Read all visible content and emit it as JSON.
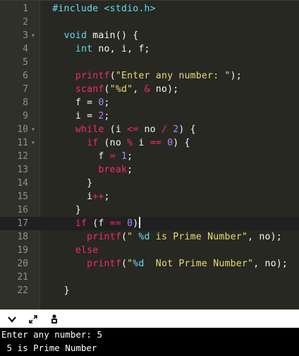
{
  "editor": {
    "line_numbers": [
      "1",
      "2",
      "3",
      "4",
      "5",
      "6",
      "7",
      "8",
      "9",
      "10",
      "11",
      "12",
      "13",
      "14",
      "15",
      "16",
      "17",
      "18",
      "19",
      "20",
      "21",
      "22"
    ],
    "fold_markers": {
      "3": "▾",
      "10": "▾",
      "11": "▾"
    },
    "active_line": 17,
    "code": {
      "include": "#include <stdio.h>",
      "void": "void",
      "main": " main() {",
      "int": "int",
      "vars": " no, i, f;",
      "printf": "printf",
      "scanf": "scanf",
      "enter_str": "\"Enter any number: \"",
      "fmt_d": "\"%d\"",
      "amp": "&",
      "no_arg": " no);",
      "f_eq": "f = ",
      "i_eq": "i = ",
      "zero": "0",
      "one": "1",
      "two": "2",
      "semi": ";",
      "while": "while",
      "while_cond_a": " (i ",
      "le": "<=",
      "while_cond_b": " no ",
      "div": "/",
      "while_cond_c": " ",
      "while_end": ") {",
      "if": "if",
      "if_cond_a": " (no ",
      "mod": "%",
      "if_cond_b": " i ",
      "eqeq": "==",
      "if_end": ") {",
      "f_assign": "f ",
      "eq": "=",
      "break": "break",
      "close": "}",
      "i_inc": "i",
      "plusplus": "++",
      "if2_a": " (f ",
      "paren_close": ")",
      "prime_str_a": "\" ",
      "prime_pct": "%d",
      "prime_str_b": " is Prime Number\"",
      "else": "else",
      "np_str_a": "\"",
      "np_str_b": "  Not Prime Number\"",
      "args_end": ", no);",
      "lp": "(",
      "comma": ", "
    }
  },
  "toolbar": {
    "icons": [
      "chevron-down-icon",
      "expand-icon",
      "settings-icon"
    ]
  },
  "console": {
    "lines": [
      "Enter any number: 5",
      " 5 is Prime Number"
    ]
  },
  "colors": {
    "keyword": "#f92672",
    "number": "#ae81ff",
    "string": "#e6db74",
    "function": "#fd971f",
    "type": "#66d9ef",
    "background": "#272822"
  }
}
